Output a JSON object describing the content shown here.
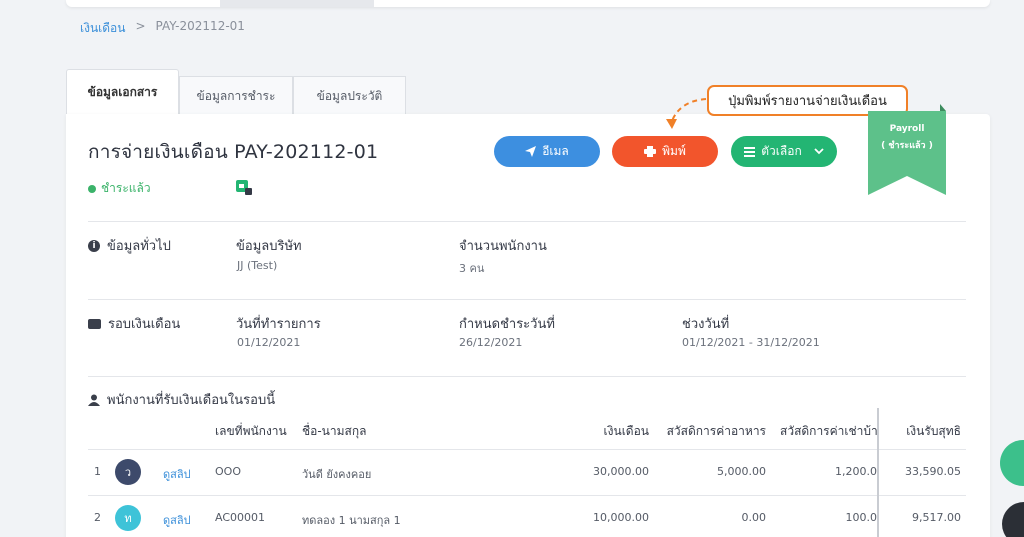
{
  "breadcrumb": {
    "root": "เงินเดือน",
    "separator": ">",
    "current": "PAY-202112-01"
  },
  "tabs": [
    "ข้อมูลเอกสาร",
    "ข้อมูลการชำระ",
    "ข้อมูลประวัติ"
  ],
  "header": {
    "title": "การจ่ายเงินเดือน PAY-202112-01",
    "status": "ชำระแล้ว"
  },
  "buttons": {
    "email": "อีเมล",
    "print": "พิมพ์",
    "options": "ตัวเลือก"
  },
  "callout": "ปุ่มพิมพ์รายงานจ่ายเงินเดือน",
  "ribbon": {
    "line1": "Payroll",
    "line2": "( ชำระแล้ว )"
  },
  "general": {
    "label": "ข้อมูลทั่วไป",
    "company_h": "ข้อมูลบริษัท",
    "company_v": "JJ (Test)",
    "employees_h": "จำนวนพนักงาน",
    "employees_v": "3 คน"
  },
  "period": {
    "label": "รอบเงินเดือน",
    "doc_date_h": "วันที่ทำรายการ",
    "doc_date_v": "01/12/2021",
    "due_h": "กำหนดชำระวันที่",
    "due_v": "26/12/2021",
    "range_h": "ช่วงวันที่",
    "range_v": "01/12/2021 - 31/12/2021"
  },
  "employees": {
    "label": "พนักงานที่รับเงินเดือนในรอบนี้",
    "columns": [
      "เลขที่พนักงาน",
      "ชื่อ-นามสกุล",
      "เงินเดือน",
      "สวัสดิการค่าอาหาร",
      "สวัสดิการค่าเช่าบ้า",
      "เงินรับสุทธิ"
    ],
    "rows": [
      {
        "no": "1",
        "avatar": "ว",
        "link": "ดูสลิป",
        "id": "OOO",
        "name": "วันดี ยังคงคอย",
        "salary": "30,000.00",
        "food": "5,000.00",
        "rent": "1,200.0",
        "net": "33,590.05"
      },
      {
        "no": "2",
        "avatar": "ท",
        "link": "ดูสลิป",
        "id": "AC00001",
        "name": "ทดลอง 1 นามสกุล 1",
        "salary": "10,000.00",
        "food": "0.00",
        "rent": "100.0",
        "net": "9,517.00"
      }
    ]
  },
  "colors": {
    "email": "#3d8fe0",
    "print": "#f2552c",
    "options": "#23b573",
    "paid": "#3bb36a",
    "ribbon": "#5dc18a",
    "callout_border": "#f08028"
  }
}
